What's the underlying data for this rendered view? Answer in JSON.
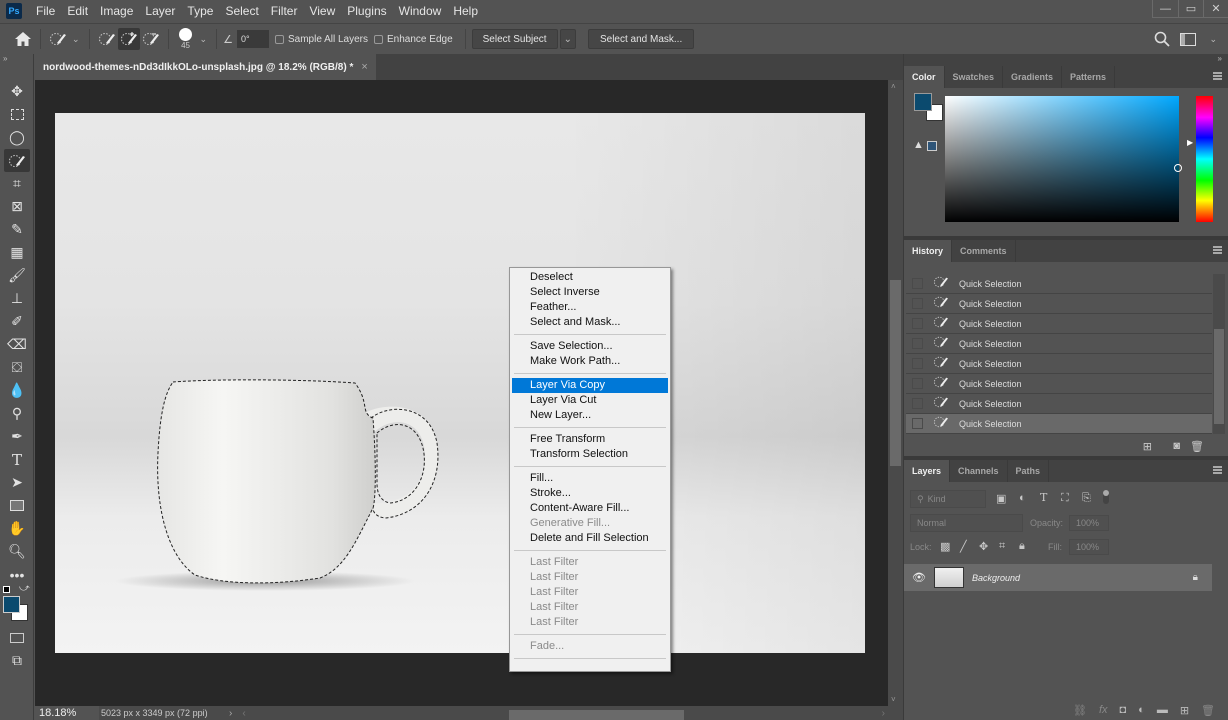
{
  "app": {
    "logo": "Ps",
    "window_controls": {
      "minimize": "—",
      "restore": "▭",
      "close": "✕"
    }
  },
  "menubar": [
    "File",
    "Edit",
    "Image",
    "Layer",
    "Type",
    "Select",
    "Filter",
    "View",
    "Plugins",
    "Window",
    "Help"
  ],
  "options_bar": {
    "brush_size": "45",
    "angle": "0°",
    "sample_all_layers": {
      "label": "Sample All Layers",
      "checked": false
    },
    "enhance_edge": {
      "label": "Enhance Edge",
      "checked": false
    },
    "select_subject": "Select Subject",
    "select_and_mask": "Select and Mask..."
  },
  "document": {
    "tab_title": "nordwood-themes-nDd3dIkkOLo-unsplash.jpg @ 18.2% (RGB/8) *",
    "close": "×"
  },
  "status_bar": {
    "zoom": "18.18%",
    "doc_info": "5023 px x 3349 px (72 ppi)"
  },
  "toolbar": {
    "tools": [
      "move",
      "rectangular-marquee",
      "lasso",
      "quick-selection",
      "crop",
      "frame",
      "eyedropper",
      "spot-healing",
      "brush",
      "clone-stamp",
      "history-brush",
      "eraser",
      "paint-bucket",
      "blur",
      "dodge",
      "pen",
      "type",
      "path-selection",
      "rectangle",
      "hand",
      "zoom",
      "more"
    ],
    "active_tool": "quick-selection",
    "foreground_color": "#0b4a6e",
    "background_color": "#ffffff"
  },
  "context_menu": {
    "groups": [
      [
        {
          "label": "Deselect"
        },
        {
          "label": "Select Inverse"
        },
        {
          "label": "Feather..."
        },
        {
          "label": "Select and Mask..."
        }
      ],
      [
        {
          "label": "Save Selection..."
        },
        {
          "label": "Make Work Path..."
        }
      ],
      [
        {
          "label": "Layer Via Copy",
          "highlighted": true
        },
        {
          "label": "Layer Via Cut"
        },
        {
          "label": "New Layer..."
        }
      ],
      [
        {
          "label": "Free Transform"
        },
        {
          "label": "Transform Selection"
        }
      ],
      [
        {
          "label": "Fill..."
        },
        {
          "label": "Stroke..."
        },
        {
          "label": "Content-Aware Fill..."
        },
        {
          "label": "Generative Fill...",
          "disabled": true
        },
        {
          "label": "Delete and Fill Selection"
        }
      ],
      [
        {
          "label": "Last Filter",
          "disabled": true
        },
        {
          "label": "Last Filter",
          "disabled": true
        },
        {
          "label": "Last Filter",
          "disabled": true
        },
        {
          "label": "Last Filter",
          "disabled": true
        },
        {
          "label": "Last Filter",
          "disabled": true
        }
      ],
      [
        {
          "label": "Fade...",
          "disabled": true
        }
      ]
    ]
  },
  "color_panel": {
    "tabs": [
      "Color",
      "Swatches",
      "Gradients",
      "Patterns"
    ],
    "active_tab": "Color",
    "foreground": "#0b4a6e",
    "background": "#ffffff",
    "hue_base": "#00a8ff",
    "warning_swatch": "#2f5578"
  },
  "history_panel": {
    "tabs": [
      "History",
      "Comments"
    ],
    "active_tab": "History",
    "items": [
      "Quick Selection",
      "Quick Selection",
      "Quick Selection",
      "Quick Selection",
      "Quick Selection",
      "Quick Selection",
      "Quick Selection",
      "Quick Selection"
    ],
    "current_index": 7
  },
  "layers_panel": {
    "tabs": [
      "Layers",
      "Channels",
      "Paths"
    ],
    "active_tab": "Layers",
    "filter_placeholder": "Kind",
    "blend_mode": "Normal",
    "opacity_label": "Opacity:",
    "opacity": "100%",
    "lock_label": "Lock:",
    "fill_label": "Fill:",
    "fill": "100%",
    "layers": [
      {
        "name": "Background",
        "visible": true,
        "locked": true
      }
    ]
  }
}
